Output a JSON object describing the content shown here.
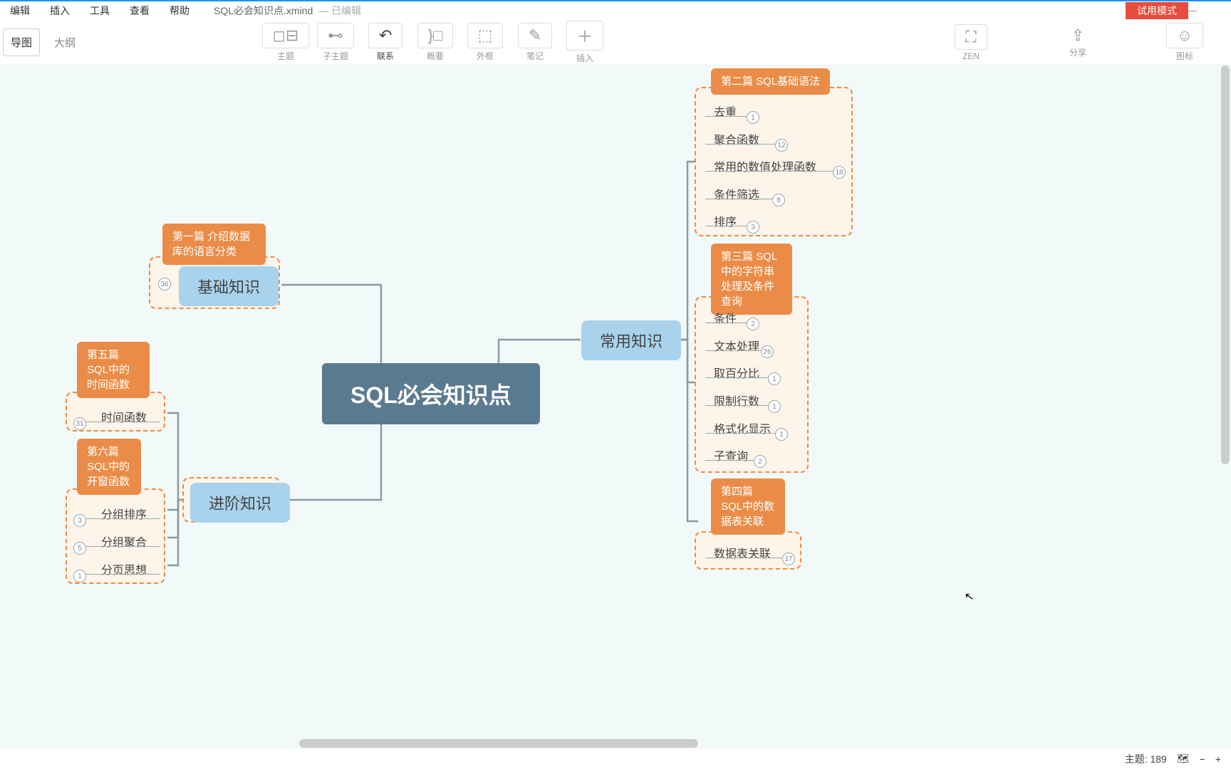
{
  "menu": {
    "edit": "编辑",
    "insert": "插入",
    "tools": "工具",
    "view": "查看",
    "help": "帮助"
  },
  "file": {
    "name": "SQL必会知识点.xmind",
    "status": "— 已编辑",
    "trial": "试用模式"
  },
  "toolbar": {
    "map": "导图",
    "outline": "大纲",
    "topic": "主题",
    "subtopic": "子主题",
    "relation": "联系",
    "summary": "概要",
    "boundary": "外框",
    "note": "笔记",
    "insert": "插入",
    "zen": "ZEN",
    "share": "分享",
    "icon": "图标"
  },
  "center": "SQL必会知识点",
  "sec1": {
    "title": "第一篇  介绍数据库的语言分类",
    "sub": "基础知识",
    "n": "36"
  },
  "sec5": {
    "title": "第五篇\nSQL中的时间函数",
    "i1": "时间函数",
    "n1": "31"
  },
  "sec6": {
    "title": "第六篇\nSQL中的开窗函数",
    "i1": "分组排序",
    "n1": "3",
    "i2": "分组聚合",
    "n2": "5",
    "i3": "分页思想",
    "n3": "1"
  },
  "adv": "进阶知识",
  "common": "常用知识",
  "sec2": {
    "title": "第二篇  SQL基础语法",
    "i1": "去重",
    "n1": "1",
    "i2": "聚合函数",
    "n2": "12",
    "i3": "常用的数值处理函数",
    "n3": "18",
    "i4": "条件筛选",
    "n4": "8",
    "i5": "排序",
    "n5": "3"
  },
  "sec3": {
    "title": "第三篇 SQL中的字符串处理及条件查询",
    "i1": "条件",
    "n1": "2",
    "i2": "文本处理",
    "n2": "26",
    "i3": "取百分比",
    "n3": "1",
    "i4": "限制行数",
    "n4": "1",
    "i5": "格式化显示",
    "n5": "1",
    "i6": "子查询",
    "n6": "2"
  },
  "sec4": {
    "title": "第四篇 SQL中的数据表关联",
    "i1": "数据表关联",
    "n1": "17"
  },
  "status": {
    "topic": "主题: 189"
  }
}
